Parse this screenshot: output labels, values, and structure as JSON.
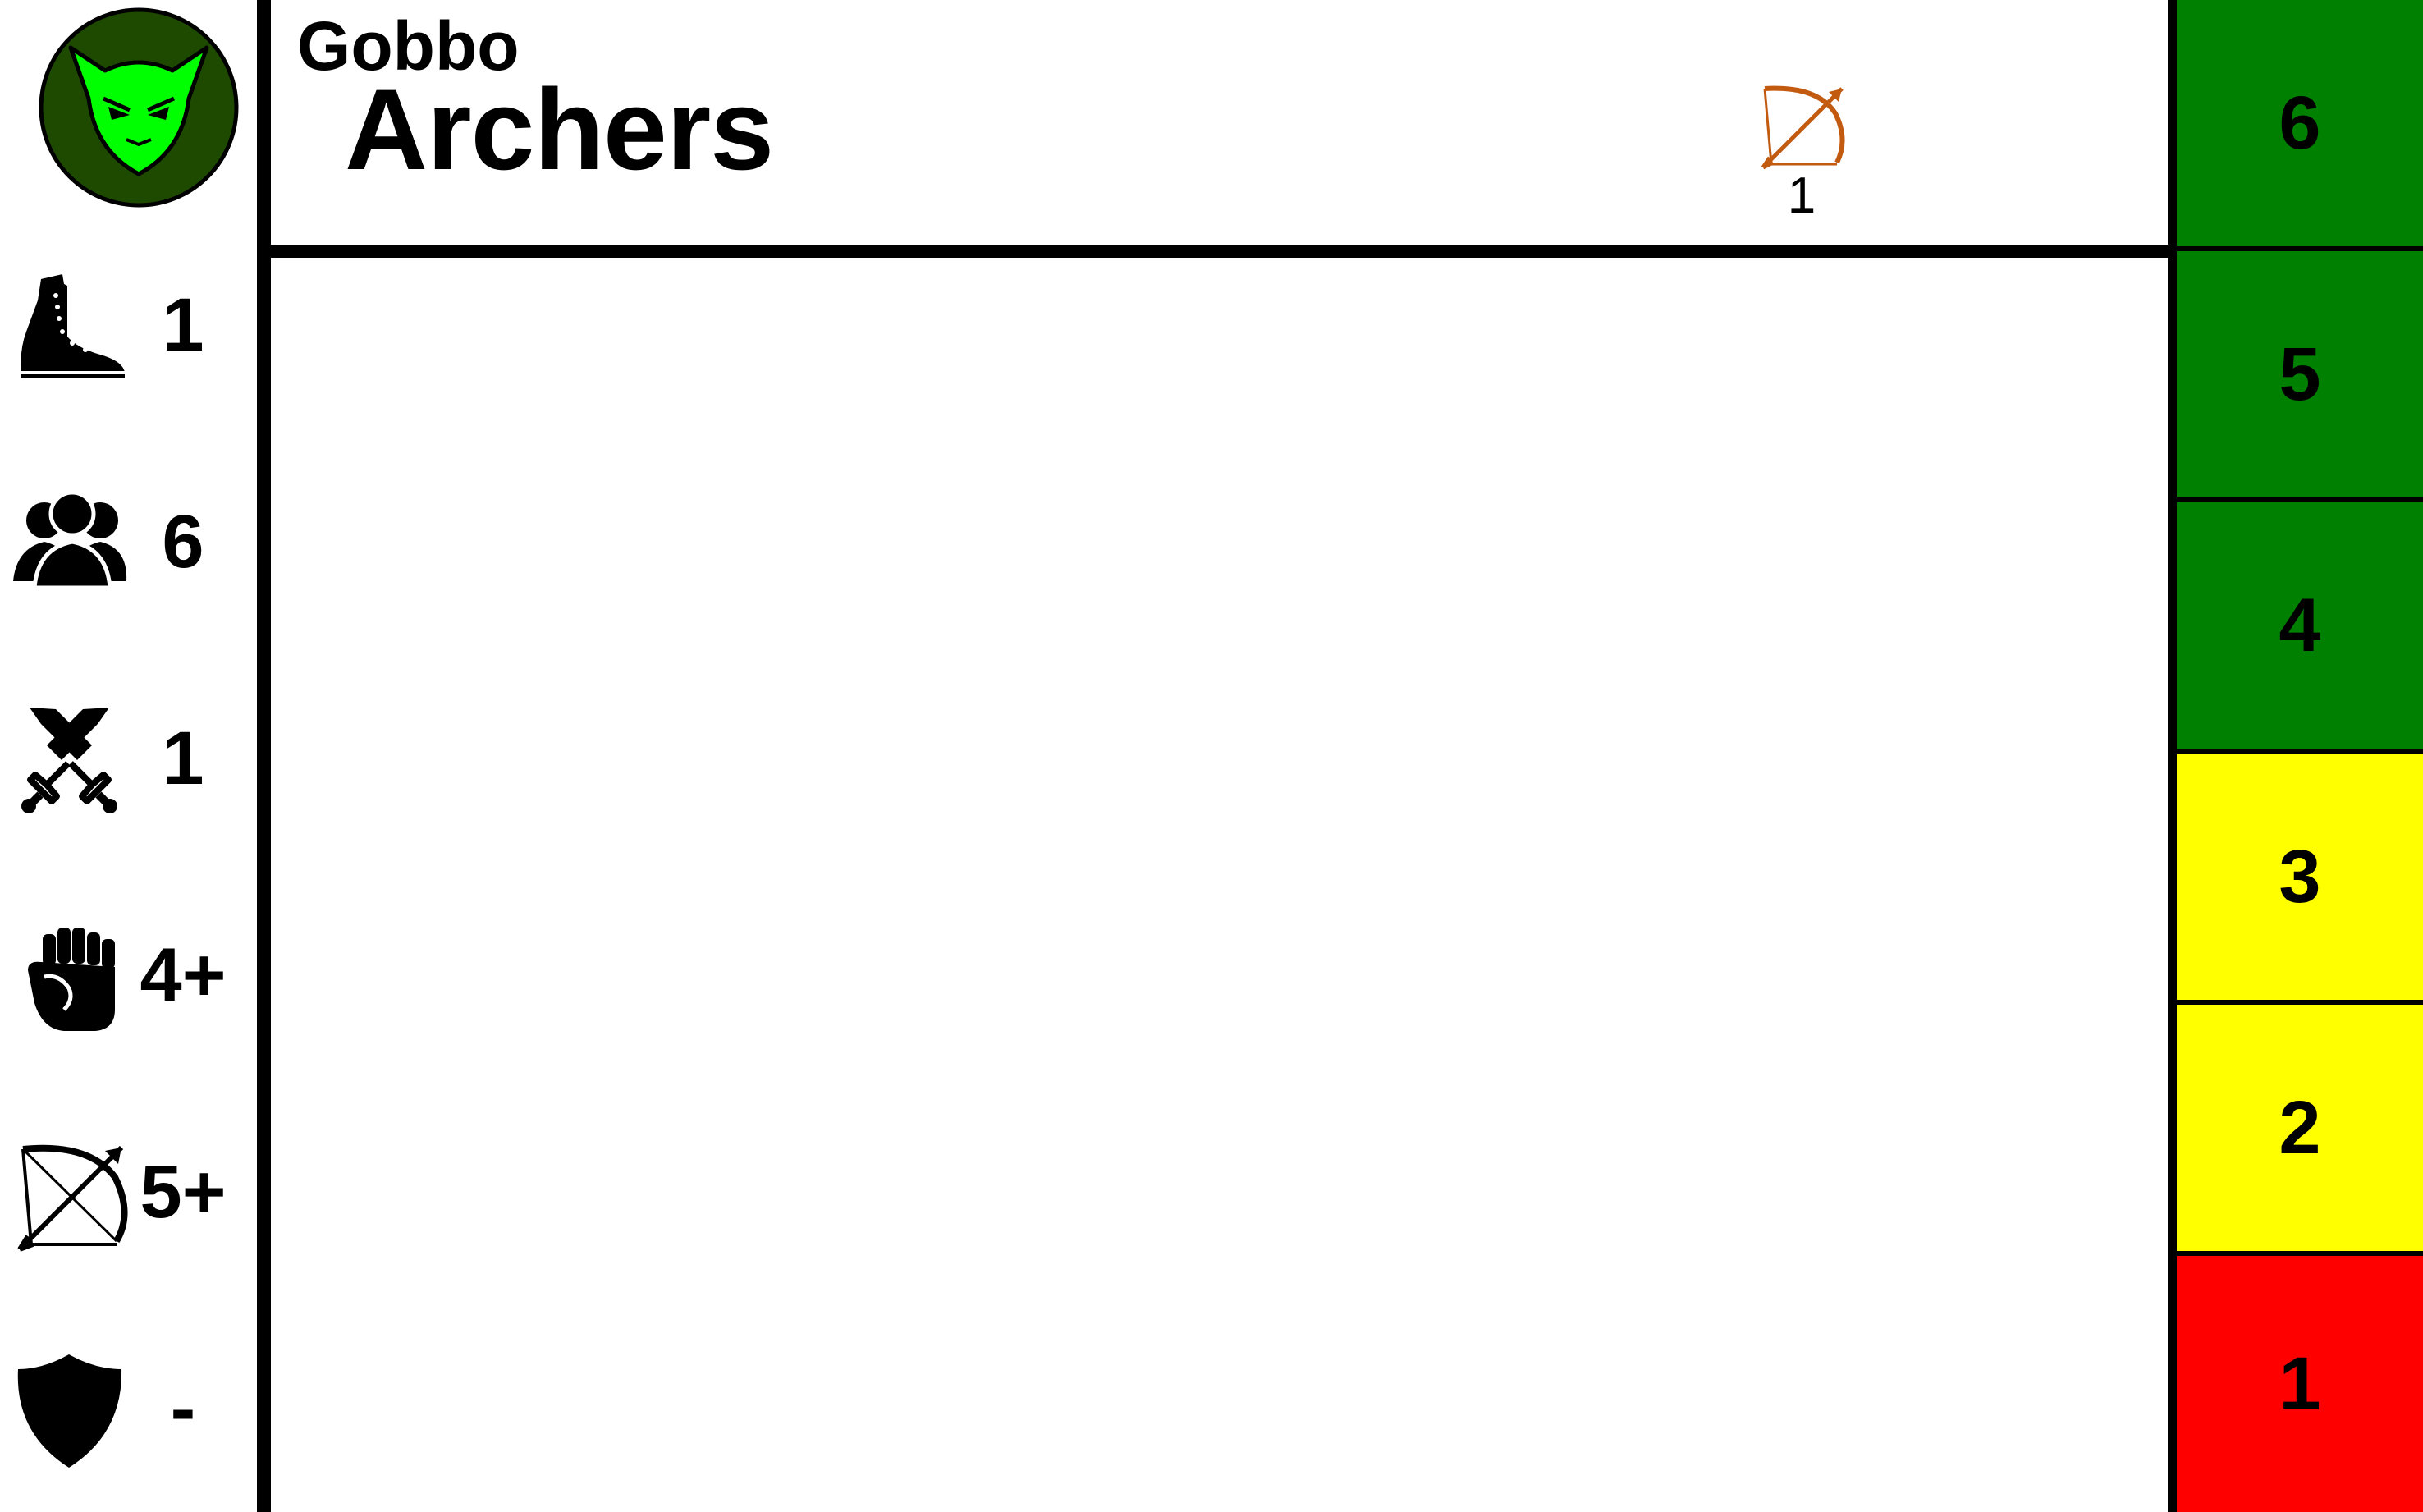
{
  "header": {
    "faction": "Gobbo",
    "unit": "Archers",
    "weapon": {
      "icon": "bow-icon",
      "color": "#c25a10",
      "value": "1"
    }
  },
  "faction_badge": {
    "icon": "goblin-head-icon",
    "ring_color": "#1e4a00",
    "face_color": "#00ff00"
  },
  "stats": [
    {
      "icon": "boot-icon",
      "value": "1"
    },
    {
      "icon": "group-icon",
      "value": "6"
    },
    {
      "icon": "crossed-swords-icon",
      "value": "1"
    },
    {
      "icon": "fist-icon",
      "value": "4+"
    },
    {
      "icon": "bow-icon",
      "value": "5+"
    },
    {
      "icon": "shield-icon",
      "value": "-"
    }
  ],
  "track": [
    {
      "value": "6",
      "color": "#008000"
    },
    {
      "value": "5",
      "color": "#008000"
    },
    {
      "value": "4",
      "color": "#008000"
    },
    {
      "value": "3",
      "color": "#ffff00"
    },
    {
      "value": "2",
      "color": "#ffff00"
    },
    {
      "value": "1",
      "color": "#ff0000"
    }
  ]
}
